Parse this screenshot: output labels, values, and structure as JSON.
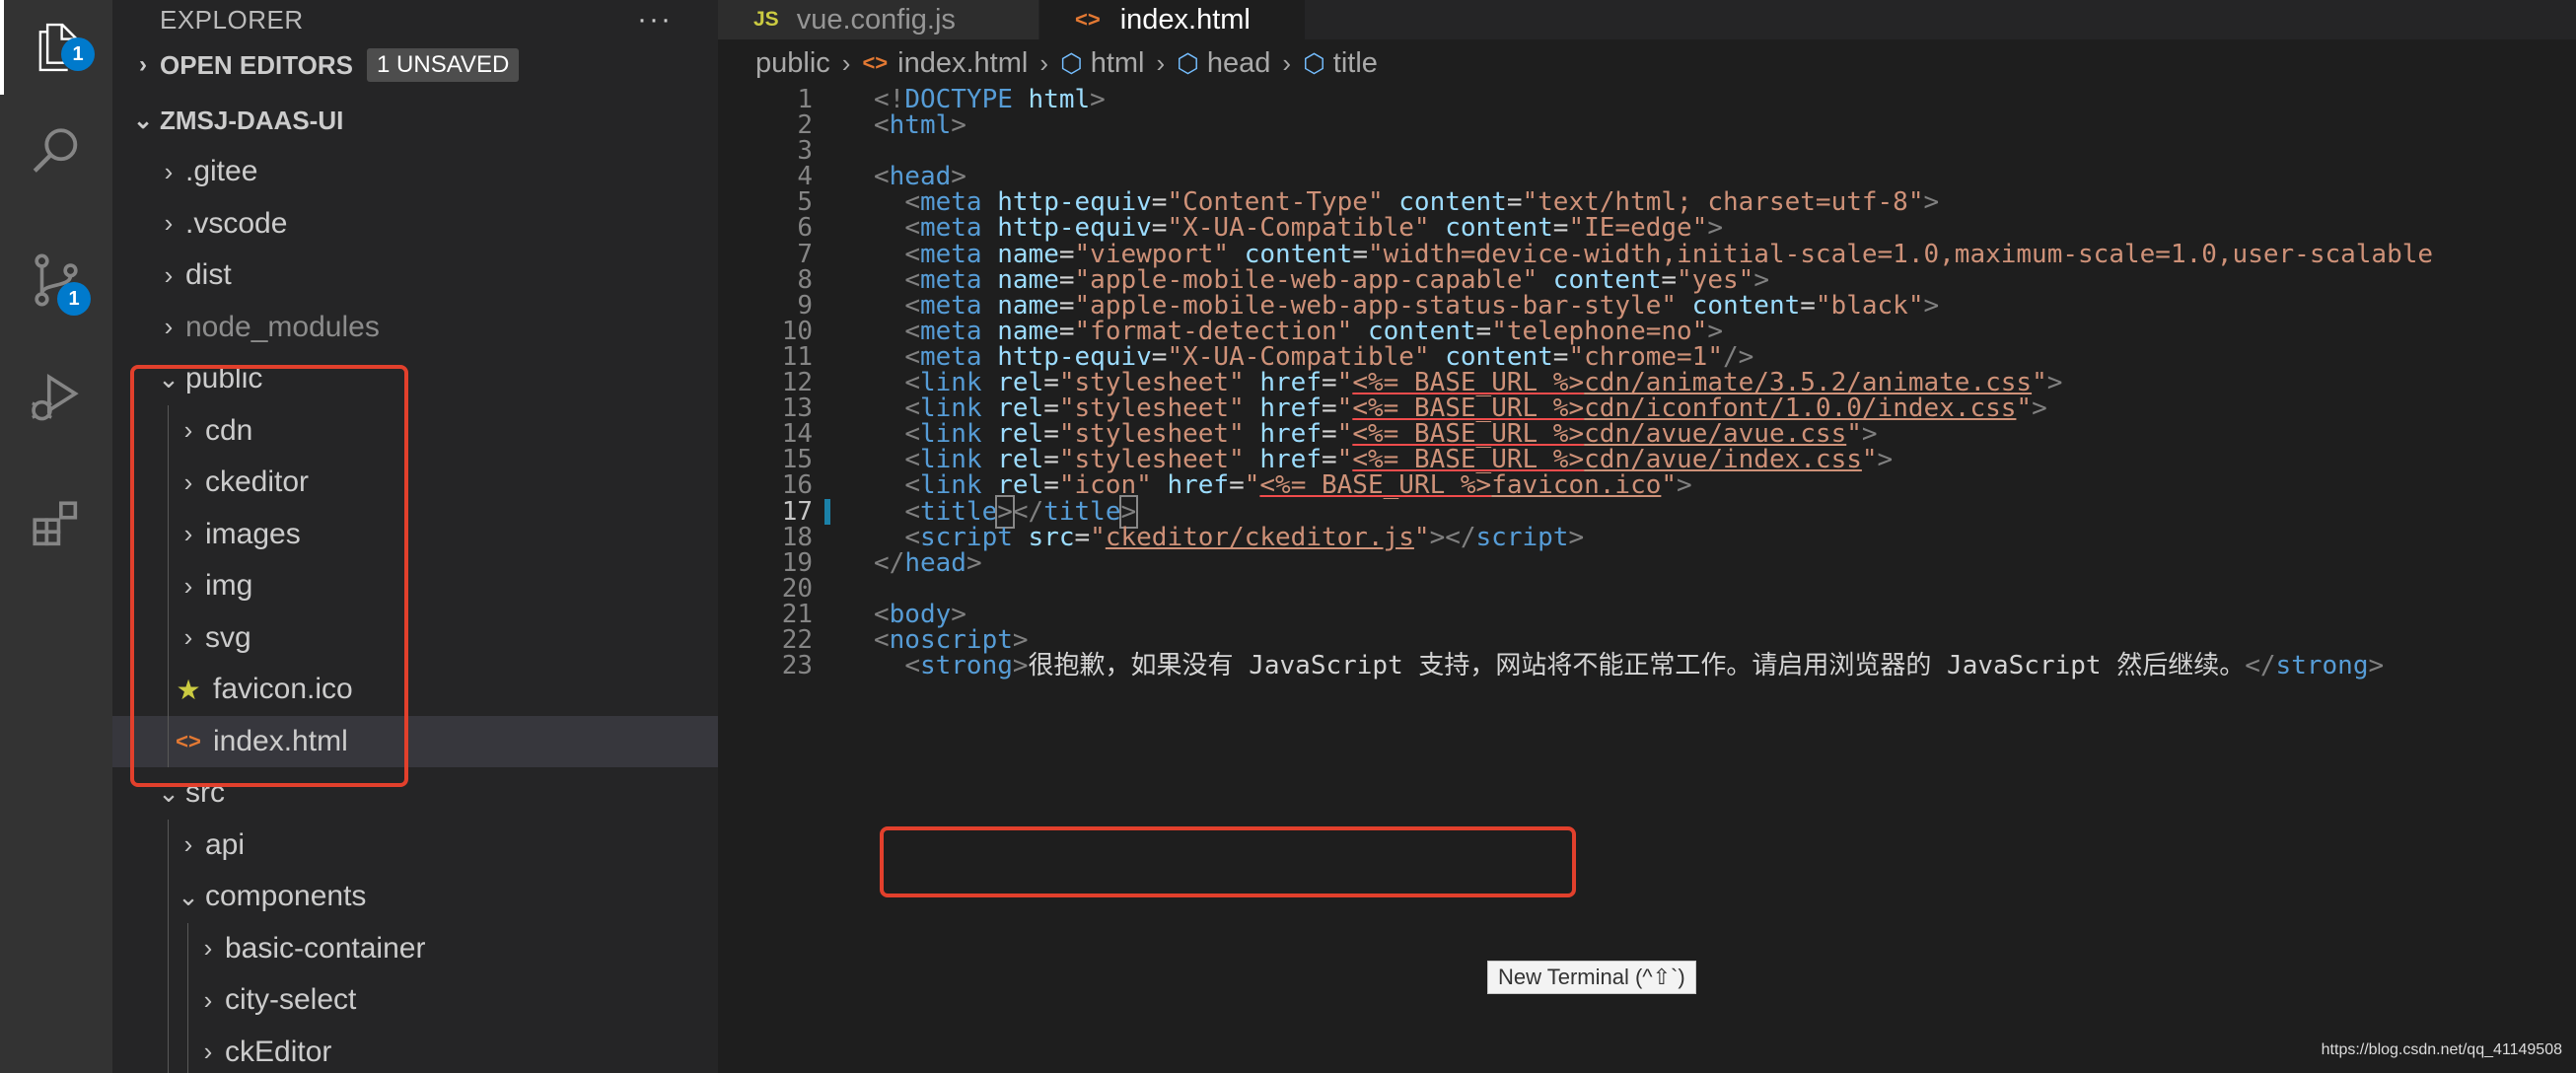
{
  "activity_bar": {
    "explorer_badge": "1",
    "source_control_badge": "1"
  },
  "sidebar": {
    "title": "EXPLORER",
    "more_actions": "···",
    "open_editors": {
      "label": "OPEN EDITORS",
      "badge": "1 UNSAVED"
    },
    "project": {
      "label": "ZMSJ-DAAS-UI"
    },
    "items": [
      {
        "label": ".gitee",
        "depth": 0,
        "type": "folder",
        "expanded": false
      },
      {
        "label": ".vscode",
        "depth": 0,
        "type": "folder",
        "expanded": false
      },
      {
        "label": "dist",
        "depth": 0,
        "type": "folder",
        "expanded": false
      },
      {
        "label": "node_modules",
        "depth": 0,
        "type": "folder",
        "expanded": false,
        "dim": true
      },
      {
        "label": "public",
        "depth": 0,
        "type": "folder",
        "expanded": true
      },
      {
        "label": "cdn",
        "depth": 1,
        "type": "folder",
        "expanded": false
      },
      {
        "label": "ckeditor",
        "depth": 1,
        "type": "folder",
        "expanded": false
      },
      {
        "label": "images",
        "depth": 1,
        "type": "folder",
        "expanded": false
      },
      {
        "label": "img",
        "depth": 1,
        "type": "folder",
        "expanded": false
      },
      {
        "label": "svg",
        "depth": 1,
        "type": "folder",
        "expanded": false
      },
      {
        "label": "favicon.ico",
        "depth": 1,
        "type": "file",
        "icon": "star-icon"
      },
      {
        "label": "index.html",
        "depth": 1,
        "type": "file",
        "icon": "html-icon",
        "selected": true
      },
      {
        "label": "src",
        "depth": 0,
        "type": "folder",
        "expanded": true
      },
      {
        "label": "api",
        "depth": 1,
        "type": "folder",
        "expanded": false
      },
      {
        "label": "components",
        "depth": 1,
        "type": "folder",
        "expanded": true
      },
      {
        "label": "basic-container",
        "depth": 2,
        "type": "folder",
        "expanded": false
      },
      {
        "label": "city-select",
        "depth": 2,
        "type": "folder",
        "expanded": false
      },
      {
        "label": "ckEditor",
        "depth": 2,
        "type": "folder",
        "expanded": false
      }
    ]
  },
  "tabs": [
    {
      "label": "vue.config.js",
      "icon": "JS",
      "active": false
    },
    {
      "label": "index.html",
      "icon": "<>",
      "active": true,
      "unsaved": true
    }
  ],
  "breadcrumb": [
    "public",
    "index.html",
    "html",
    "head",
    "title"
  ],
  "code": {
    "current_line": 17,
    "lines": [
      {
        "n": 1,
        "tokens": [
          [
            "t",
            "<!"
          ],
          [
            "tag",
            "DOCTYPE"
          ],
          [
            "attr",
            " html"
          ],
          [
            "t",
            ">"
          ]
        ]
      },
      {
        "n": 2,
        "tokens": [
          [
            "t",
            "<"
          ],
          [
            "tag",
            "html"
          ],
          [
            "t",
            ">"
          ]
        ]
      },
      {
        "n": 3,
        "tokens": []
      },
      {
        "n": 4,
        "tokens": [
          [
            "t",
            "<"
          ],
          [
            "tag",
            "head"
          ],
          [
            "t",
            ">"
          ]
        ]
      },
      {
        "n": 5,
        "tokens": [
          [
            "txtc",
            "  "
          ],
          [
            "t",
            "<"
          ],
          [
            "tag",
            "meta"
          ],
          [
            "txtc",
            " "
          ],
          [
            "attr",
            "http-equiv"
          ],
          [
            "txtc",
            "="
          ],
          [
            "str",
            "\"Content-Type\""
          ],
          [
            "txtc",
            " "
          ],
          [
            "attr",
            "content"
          ],
          [
            "txtc",
            "="
          ],
          [
            "str",
            "\"text/html; charset=utf-8\""
          ],
          [
            "t",
            ">"
          ]
        ]
      },
      {
        "n": 6,
        "tokens": [
          [
            "txtc",
            "  "
          ],
          [
            "t",
            "<"
          ],
          [
            "tag",
            "meta"
          ],
          [
            "txtc",
            " "
          ],
          [
            "attr",
            "http-equiv"
          ],
          [
            "txtc",
            "="
          ],
          [
            "str",
            "\"X-UA-Compatible\""
          ],
          [
            "txtc",
            " "
          ],
          [
            "attr",
            "content"
          ],
          [
            "txtc",
            "="
          ],
          [
            "str",
            "\"IE=edge\""
          ],
          [
            "t",
            ">"
          ]
        ]
      },
      {
        "n": 7,
        "tokens": [
          [
            "txtc",
            "  "
          ],
          [
            "t",
            "<"
          ],
          [
            "tag",
            "meta"
          ],
          [
            "txtc",
            " "
          ],
          [
            "attr",
            "name"
          ],
          [
            "txtc",
            "="
          ],
          [
            "str",
            "\"viewport\""
          ],
          [
            "txtc",
            " "
          ],
          [
            "attr",
            "content"
          ],
          [
            "txtc",
            "="
          ],
          [
            "str",
            "\"width=device-width,initial-scale=1.0,maximum-scale=1.0,user-scalable"
          ]
        ]
      },
      {
        "n": 8,
        "tokens": [
          [
            "txtc",
            "  "
          ],
          [
            "t",
            "<"
          ],
          [
            "tag",
            "meta"
          ],
          [
            "txtc",
            " "
          ],
          [
            "attr",
            "name"
          ],
          [
            "txtc",
            "="
          ],
          [
            "str",
            "\"apple-mobile-web-app-capable\""
          ],
          [
            "txtc",
            " "
          ],
          [
            "attr",
            "content"
          ],
          [
            "txtc",
            "="
          ],
          [
            "str",
            "\"yes\""
          ],
          [
            "t",
            ">"
          ]
        ]
      },
      {
        "n": 9,
        "tokens": [
          [
            "txtc",
            "  "
          ],
          [
            "t",
            "<"
          ],
          [
            "tag",
            "meta"
          ],
          [
            "txtc",
            " "
          ],
          [
            "attr",
            "name"
          ],
          [
            "txtc",
            "="
          ],
          [
            "str",
            "\"apple-mobile-web-app-status-bar-style\""
          ],
          [
            "txtc",
            " "
          ],
          [
            "attr",
            "content"
          ],
          [
            "txtc",
            "="
          ],
          [
            "str",
            "\"black\""
          ],
          [
            "t",
            ">"
          ]
        ]
      },
      {
        "n": 10,
        "tokens": [
          [
            "txtc",
            "  "
          ],
          [
            "t",
            "<"
          ],
          [
            "tag",
            "meta"
          ],
          [
            "txtc",
            " "
          ],
          [
            "attr",
            "name"
          ],
          [
            "txtc",
            "="
          ],
          [
            "str",
            "\"format-detection\""
          ],
          [
            "txtc",
            " "
          ],
          [
            "attr",
            "content"
          ],
          [
            "txtc",
            "="
          ],
          [
            "str",
            "\"telephone=no\""
          ],
          [
            "t",
            ">"
          ]
        ]
      },
      {
        "n": 11,
        "tokens": [
          [
            "txtc",
            "  "
          ],
          [
            "t",
            "<"
          ],
          [
            "tag",
            "meta"
          ],
          [
            "txtc",
            " "
          ],
          [
            "attr",
            "http-equiv"
          ],
          [
            "txtc",
            "="
          ],
          [
            "str",
            "\"X-UA-Compatible\""
          ],
          [
            "txtc",
            " "
          ],
          [
            "attr",
            "content"
          ],
          [
            "txtc",
            "="
          ],
          [
            "str",
            "\"chrome=1\""
          ],
          [
            "t",
            "/>"
          ]
        ]
      },
      {
        "n": 12,
        "tokens": [
          [
            "txtc",
            "  "
          ],
          [
            "t",
            "<"
          ],
          [
            "tag",
            "link"
          ],
          [
            "txtc",
            " "
          ],
          [
            "attr",
            "rel"
          ],
          [
            "txtc",
            "="
          ],
          [
            "str",
            "\"stylesheet\""
          ],
          [
            "txtc",
            " "
          ],
          [
            "attr",
            "href"
          ],
          [
            "txtc",
            "="
          ],
          [
            "str",
            "\""
          ],
          [
            "str ul",
            "<%= BASE_URL %>"
          ],
          [
            "str ulp",
            "cdn/animate/3.5.2/animate.css"
          ],
          [
            "str",
            "\""
          ],
          [
            "t",
            ">"
          ]
        ]
      },
      {
        "n": 13,
        "tokens": [
          [
            "txtc",
            "  "
          ],
          [
            "t",
            "<"
          ],
          [
            "tag",
            "link"
          ],
          [
            "txtc",
            " "
          ],
          [
            "attr",
            "rel"
          ],
          [
            "txtc",
            "="
          ],
          [
            "str",
            "\"stylesheet\""
          ],
          [
            "txtc",
            " "
          ],
          [
            "attr",
            "href"
          ],
          [
            "txtc",
            "="
          ],
          [
            "str",
            "\""
          ],
          [
            "str ul",
            "<%= BASE_URL %>"
          ],
          [
            "str ulp",
            "cdn/iconfont/1.0.0/index.css"
          ],
          [
            "str",
            "\""
          ],
          [
            "t",
            ">"
          ]
        ]
      },
      {
        "n": 14,
        "tokens": [
          [
            "txtc",
            "  "
          ],
          [
            "t",
            "<"
          ],
          [
            "tag",
            "link"
          ],
          [
            "txtc",
            " "
          ],
          [
            "attr",
            "rel"
          ],
          [
            "txtc",
            "="
          ],
          [
            "str",
            "\"stylesheet\""
          ],
          [
            "txtc",
            " "
          ],
          [
            "attr",
            "href"
          ],
          [
            "txtc",
            "="
          ],
          [
            "str",
            "\""
          ],
          [
            "str ul",
            "<%= BASE_URL %>"
          ],
          [
            "str ulp",
            "cdn/avue/avue.css"
          ],
          [
            "str",
            "\""
          ],
          [
            "t",
            ">"
          ]
        ]
      },
      {
        "n": 15,
        "tokens": [
          [
            "txtc",
            "  "
          ],
          [
            "t",
            "<"
          ],
          [
            "tag",
            "link"
          ],
          [
            "txtc",
            " "
          ],
          [
            "attr",
            "rel"
          ],
          [
            "txtc",
            "="
          ],
          [
            "str",
            "\"stylesheet\""
          ],
          [
            "txtc",
            " "
          ],
          [
            "attr",
            "href"
          ],
          [
            "txtc",
            "="
          ],
          [
            "str",
            "\""
          ],
          [
            "str ul",
            "<%= BASE_URL %>"
          ],
          [
            "str ulp",
            "cdn/avue/index.css"
          ],
          [
            "str",
            "\""
          ],
          [
            "t",
            ">"
          ]
        ]
      },
      {
        "n": 16,
        "tokens": [
          [
            "txtc",
            "  "
          ],
          [
            "t",
            "<"
          ],
          [
            "tag",
            "link"
          ],
          [
            "txtc",
            " "
          ],
          [
            "attr",
            "rel"
          ],
          [
            "txtc",
            "="
          ],
          [
            "str",
            "\"icon\""
          ],
          [
            "txtc",
            " "
          ],
          [
            "attr",
            "href"
          ],
          [
            "txtc",
            "="
          ],
          [
            "str",
            "\""
          ],
          [
            "str ul",
            "<%= BASE_URL %>"
          ],
          [
            "str ulp",
            "favicon.ico"
          ],
          [
            "str",
            "\""
          ],
          [
            "t",
            ">"
          ]
        ]
      },
      {
        "n": 17,
        "tokens": [
          [
            "txtc",
            "  "
          ],
          [
            "t",
            "<"
          ],
          [
            "tag",
            "title"
          ],
          [
            "t bracket-match",
            ">"
          ],
          [
            "t",
            "</"
          ],
          [
            "tag",
            "title"
          ],
          [
            "t bracket-match",
            ">"
          ]
        ]
      },
      {
        "n": 18,
        "tokens": [
          [
            "txtc",
            "  "
          ],
          [
            "t",
            "<"
          ],
          [
            "tag",
            "script"
          ],
          [
            "txtc",
            " "
          ],
          [
            "attr",
            "src"
          ],
          [
            "txtc",
            "="
          ],
          [
            "str",
            "\""
          ],
          [
            "str ulp",
            "ckeditor/ckeditor.js"
          ],
          [
            "str",
            "\""
          ],
          [
            "t",
            "></"
          ],
          [
            "tag",
            "script"
          ],
          [
            "t",
            ">"
          ]
        ]
      },
      {
        "n": 19,
        "tokens": [
          [
            "t",
            "</"
          ],
          [
            "tag",
            "head"
          ],
          [
            "t",
            ">"
          ]
        ]
      },
      {
        "n": 20,
        "tokens": []
      },
      {
        "n": 21,
        "tokens": [
          [
            "t",
            "<"
          ],
          [
            "tag",
            "body"
          ],
          [
            "t",
            ">"
          ]
        ]
      },
      {
        "n": 22,
        "tokens": [
          [
            "t",
            "<"
          ],
          [
            "tag",
            "noscript"
          ],
          [
            "t",
            ">"
          ]
        ]
      },
      {
        "n": 23,
        "tokens": [
          [
            "txtc",
            "  "
          ],
          [
            "t",
            "<"
          ],
          [
            "tag",
            "strong"
          ],
          [
            "t",
            ">"
          ],
          [
            "txtc",
            "很抱歉，如果没有 JavaScript 支持，网站将不能正常工作。请启用浏览器的 JavaScript 然后继续。"
          ],
          [
            "t",
            "</"
          ],
          [
            "tag",
            "strong"
          ],
          [
            "t",
            ">"
          ]
        ]
      }
    ]
  },
  "tooltip": "New Terminal (^⇧`)",
  "watermark": "https://blog.csdn.net/qq_41149508"
}
